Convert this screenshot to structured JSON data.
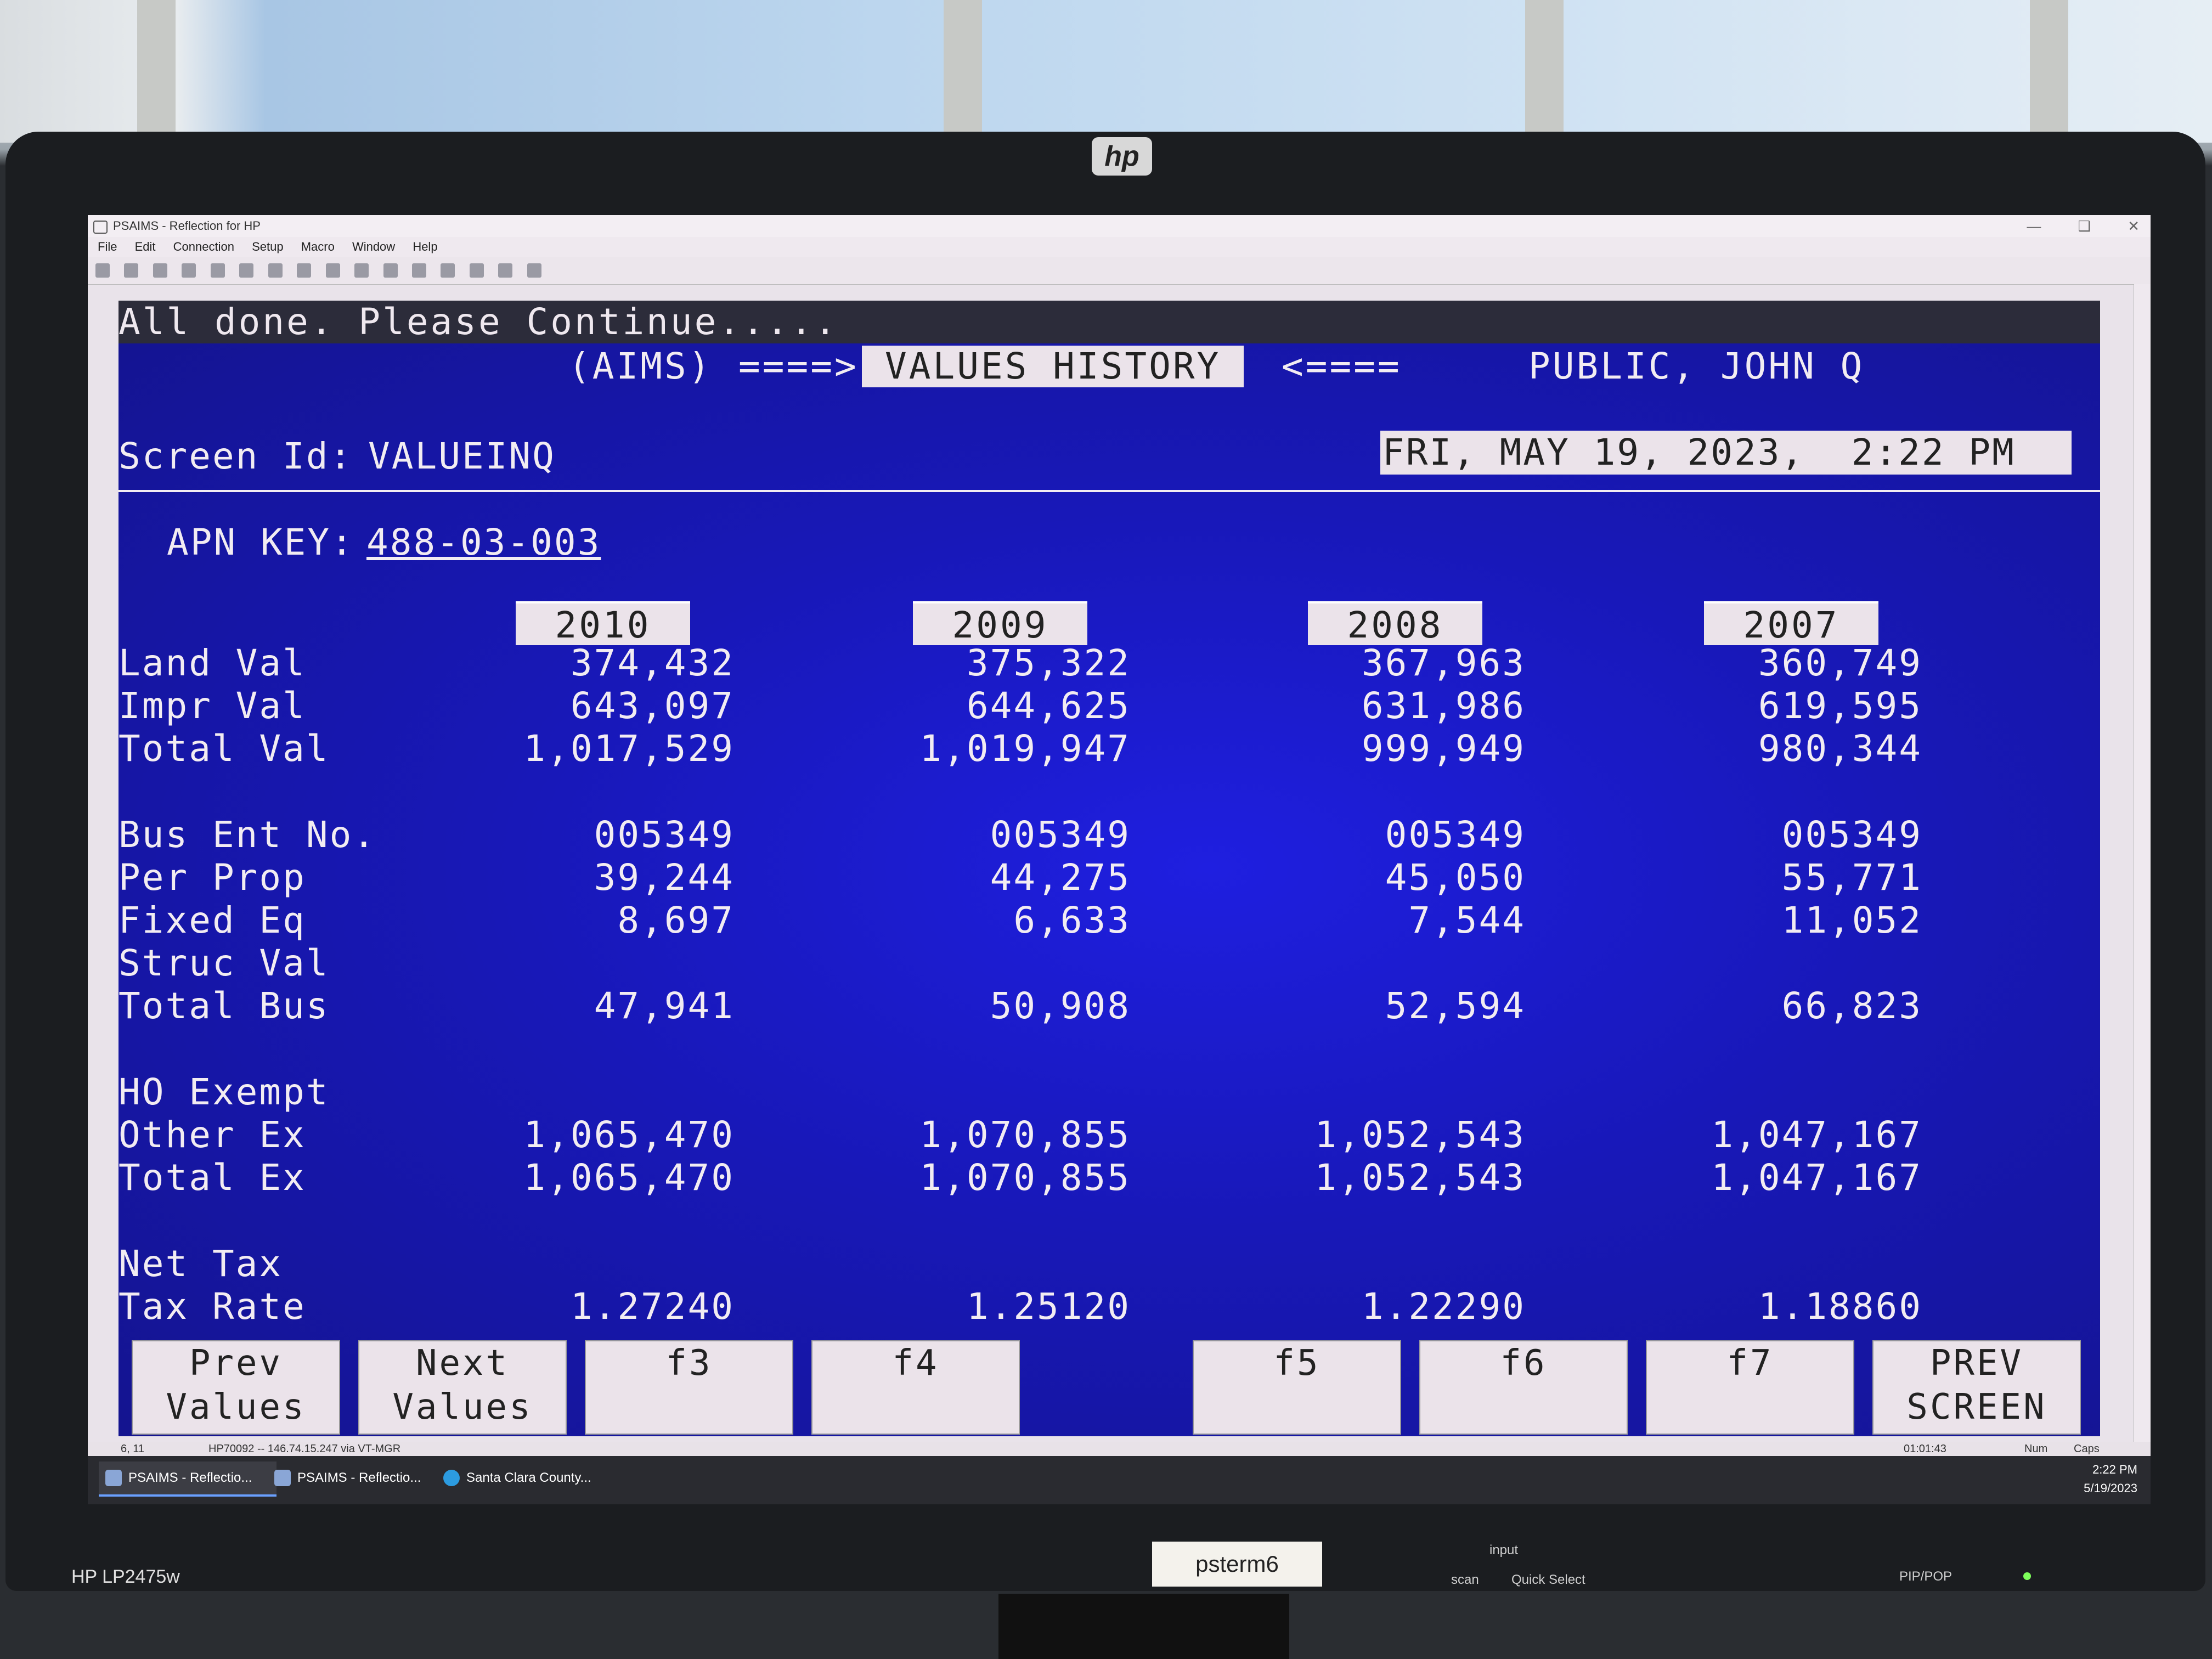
{
  "monitor": {
    "brand_logo": "hp",
    "model": "HP LP2475w",
    "sticker": "psterm6",
    "input_label": "input",
    "buttons": [
      "scan",
      "Quick Select",
      "PIP/POP"
    ]
  },
  "window": {
    "title": "PSAIMS - Reflection for HP",
    "menu": [
      "File",
      "Edit",
      "Connection",
      "Setup",
      "Macro",
      "Window",
      "Help"
    ]
  },
  "terminal": {
    "status_message": "All done.  Please Continue.....",
    "header": {
      "system": "(AIMS)",
      "arrow_right": "====>",
      "screen_name": "VALUES HISTORY",
      "arrow_left": "<====",
      "owner": "PUBLIC, JOHN Q"
    },
    "screen_id_label": "Screen Id:",
    "screen_id": "VALUEINQ",
    "datetime": "FRI, MAY 19, 2023,  2:22 PM",
    "apn_label": "APN KEY:",
    "apn_value": "488-03-003",
    "years": [
      "2010",
      "2009",
      "2008",
      "2007"
    ],
    "rows": [
      {
        "label": "Land Val",
        "values": [
          "374,432",
          "375,322",
          "367,963",
          "360,749"
        ]
      },
      {
        "label": "Impr Val",
        "values": [
          "643,097",
          "644,625",
          "631,986",
          "619,595"
        ]
      },
      {
        "label": "Total Val",
        "values": [
          "1,017,529",
          "1,019,947",
          "999,949",
          "980,344"
        ]
      },
      {
        "label": "Bus Ent No.",
        "values": [
          "005349",
          "005349",
          "005349",
          "005349"
        ]
      },
      {
        "label": "Per Prop",
        "values": [
          "39,244",
          "44,275",
          "45,050",
          "55,771"
        ]
      },
      {
        "label": "Fixed Eq",
        "values": [
          "8,697",
          "6,633",
          "7,544",
          "11,052"
        ]
      },
      {
        "label": "Struc Val",
        "values": [
          "",
          "",
          "",
          ""
        ]
      },
      {
        "label": "Total Bus",
        "values": [
          "47,941",
          "50,908",
          "52,594",
          "66,823"
        ]
      },
      {
        "label": "HO Exempt",
        "values": [
          "",
          "",
          "",
          ""
        ]
      },
      {
        "label": "Other Ex",
        "values": [
          "1,065,470",
          "1,070,855",
          "1,052,543",
          "1,047,167"
        ]
      },
      {
        "label": "Total Ex",
        "values": [
          "1,065,470",
          "1,070,855",
          "1,052,543",
          "1,047,167"
        ]
      },
      {
        "label": "Net Tax",
        "values": [
          "",
          "",
          "",
          ""
        ]
      },
      {
        "label": "Tax Rate",
        "values": [
          "1.27240",
          "1.25120",
          "1.22290",
          "1.18860"
        ]
      }
    ],
    "function_keys": [
      {
        "line1": "Prev",
        "line2": "Values"
      },
      {
        "line1": "Next",
        "line2": "Values"
      },
      {
        "line1": "f3",
        "line2": ""
      },
      {
        "line1": "f4",
        "line2": ""
      },
      {
        "line1": "f5",
        "line2": ""
      },
      {
        "line1": "f6",
        "line2": ""
      },
      {
        "line1": "f7",
        "line2": ""
      },
      {
        "line1": "PREV",
        "line2": "SCREEN"
      }
    ]
  },
  "statusbar": {
    "cursor": "6, 11",
    "connection": "HP70092 -- 146.74.15.247 via VT-MGR",
    "elapsed": "01:01:43",
    "num": "Num",
    "caps": "Caps"
  },
  "taskbar": {
    "items": [
      "PSAIMS - Reflectio...",
      "PSAIMS - Reflectio...",
      "Santa Clara County..."
    ],
    "time": "2:22 PM",
    "date": "5/19/2023"
  }
}
